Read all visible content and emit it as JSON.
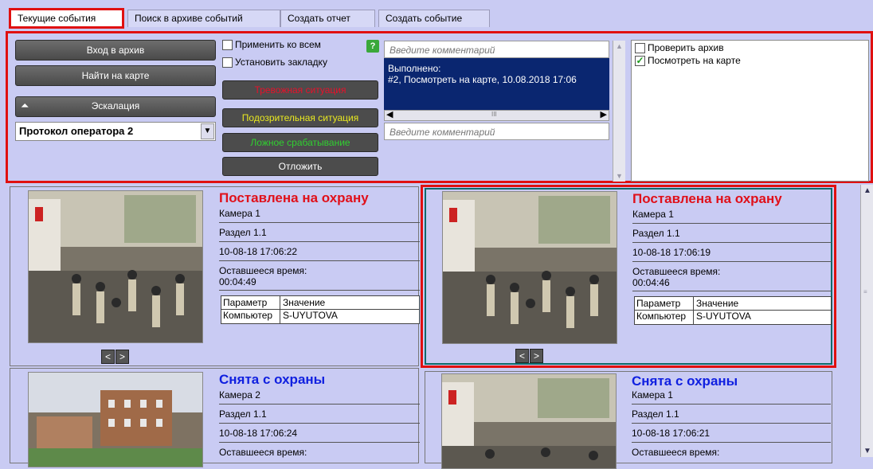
{
  "tabs": [
    {
      "label": "Текущие события"
    },
    {
      "label": "Поиск в архиве событий"
    },
    {
      "label": "Создать отчет"
    },
    {
      "label": "Создать событие"
    }
  ],
  "controls": {
    "archive_button": "Вход в архив",
    "map_button": "Найти на карте",
    "escalation_button": "Эскалация",
    "protocol_select": "Протокол оператора 2",
    "apply_all": "Применить ко всем",
    "set_bookmark": "Установить закладку",
    "help_badge": "?",
    "alarm_button": "Тревожная ситуация",
    "suspicious_button": "Подозрительная ситуация",
    "false_button": "Ложное срабатывание",
    "postpone_button": "Отложить",
    "comment_placeholder_top": "Введите комментарий",
    "done_label": "Выполнено:",
    "done_text": "#2, Посмотреть на карте, 10.08.2018 17:06",
    "scroll_mark": "III",
    "comment_placeholder_bottom": "Введите комментарий",
    "actions": [
      {
        "label": "Проверить архив",
        "checked": false
      },
      {
        "label": "Посмотреть на карте",
        "checked": true
      }
    ]
  },
  "events": [
    {
      "title": "Поставлена на охрану",
      "title_color": "#e0101a",
      "camera": "Камера 1",
      "section": "Раздел 1.1",
      "datetime": "10-08-18 17:06:22",
      "remaining_label": "Оставшееся время:",
      "remaining": "00:04:49",
      "param_header": "Параметр",
      "value_header": "Значение",
      "param": "Компьютер",
      "value": "S-UYUTOVA"
    },
    {
      "title": "Поставлена на охрану",
      "title_color": "#e0101a",
      "camera": "Камера 1",
      "section": "Раздел 1.1",
      "datetime": "10-08-18 17:06:19",
      "remaining_label": "Оставшееся время:",
      "remaining": "00:04:46",
      "param_header": "Параметр",
      "value_header": "Значение",
      "param": "Компьютер",
      "value": "S-UYUTOVA"
    },
    {
      "title": "Снята с охраны",
      "title_color": "#1020e0",
      "camera": "Камера 2",
      "section": "Раздел 1.1",
      "datetime": "10-08-18 17:06:24",
      "remaining_label": "Оставшееся время:"
    },
    {
      "title": "Снята с охраны",
      "title_color": "#1020e0",
      "camera": "Камера 1",
      "section": "Раздел 1.1",
      "datetime": "10-08-18 17:06:21",
      "remaining_label": "Оставшееся время:"
    }
  ],
  "nav": {
    "prev": "<",
    "next": ">"
  },
  "colors": {
    "alarm": "#e8102a",
    "suspicious": "#e8e820",
    "false_alarm": "#30d030",
    "highlight": "#e01010",
    "selected_border": "#0b6b6b",
    "done_bg": "#0a2670"
  }
}
